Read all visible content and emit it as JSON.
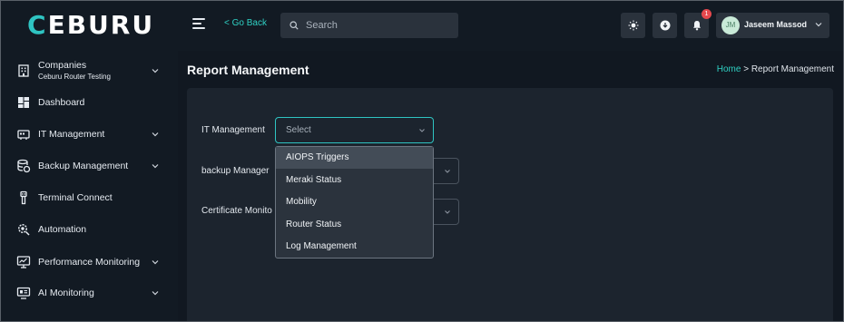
{
  "brand": {
    "logo_text": "CEBURU"
  },
  "topbar": {
    "go_back": "< Go Back",
    "search_placeholder": "Search",
    "notification_count": "1",
    "user": {
      "initials": "JM",
      "name": "Jaseem Massod"
    }
  },
  "sidebar": {
    "company": {
      "label": "Companies",
      "sub": "Ceburu Router Testing"
    },
    "items": [
      {
        "label": "Dashboard"
      },
      {
        "label": "IT Management"
      },
      {
        "label": "Backup Management"
      },
      {
        "label": "Terminal Connect"
      },
      {
        "label": "Automation"
      },
      {
        "label": "Performance Monitoring"
      },
      {
        "label": "AI Monitoring"
      }
    ]
  },
  "main": {
    "title": "Report Management",
    "breadcrumb": {
      "home": "Home",
      "separator": ">",
      "current": "Report Management"
    },
    "form": {
      "it_management_label": "IT Management",
      "it_management_value": "Select",
      "backup_label": "backup Manager",
      "certificate_label": "Certificate Monito"
    },
    "dropdown_options": [
      "AIOPS Triggers",
      "Meraki Status",
      "Mobility",
      "Router Status",
      "Log Management"
    ]
  },
  "colors": {
    "accent": "#2fc4c2",
    "background": "#111821",
    "card": "#1c242e",
    "badge": "#e5484d"
  }
}
